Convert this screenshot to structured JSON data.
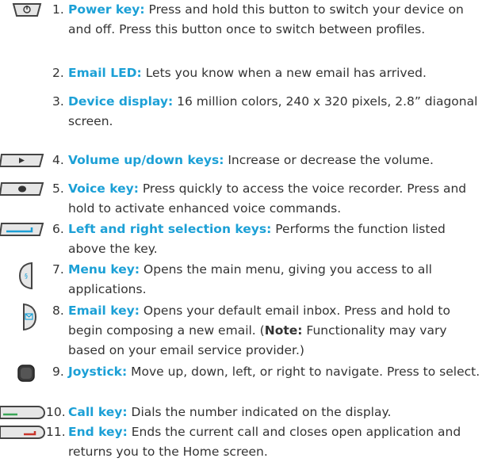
{
  "items": [
    {
      "num": "1.",
      "term": "Power key:",
      "desc": " Press and hold this button to switch your device on and off. Press this button once to switch between profiles.",
      "icon": "power-key-icon"
    },
    {
      "num": "2.",
      "term": "Email LED:",
      "desc": " Lets you know when a new email has arrived.",
      "icon": ""
    },
    {
      "num": "3.",
      "term": "Device display:",
      "desc": " 16 million colors, 240 x 320 pixels, 2.8” diagonal screen.",
      "icon": ""
    },
    {
      "num": "4.",
      "term": "Volume up/down keys:",
      "desc": " Increase or decrease the volume.",
      "icon": "volume-key-icon"
    },
    {
      "num": "5.",
      "term": "Voice key:",
      "desc": " Press quickly to access the voice recorder. Press and hold to activate enhanced voice commands.",
      "icon": "voice-key-icon"
    },
    {
      "num": "6.",
      "term": "Left and right selection keys:",
      "desc": " Performs the function listed above the key.",
      "icon": "selection-key-icon"
    },
    {
      "num": "7.",
      "term": "Menu key:",
      "desc": " Opens the main menu, giving you access to all applications.",
      "icon": "menu-key-icon"
    },
    {
      "num": "8.",
      "term": "Email key:",
      "desc_before": " Opens your default email inbox. Press and hold to begin composing a new email. (",
      "note_label": "Note:",
      "desc_after": " Functionality may vary based on your email service provider.)",
      "icon": "email-key-icon"
    },
    {
      "num": "9.",
      "term": "Joystick:",
      "desc": " Move up, down, left, or right to navigate. Press to select.",
      "icon": "joystick-icon"
    },
    {
      "num": "10.",
      "term": "Call key:",
      "desc": " Dials the number indicated on the display.",
      "icon": "call-key-icon"
    },
    {
      "num": "11.",
      "term": "End key:",
      "desc": " Ends the current call and closes open application and returns you to the Home screen.",
      "icon": "end-key-icon"
    }
  ],
  "colors": {
    "term": "#1ca0d6",
    "text": "#333333",
    "call": "#3aa657",
    "end": "#c8352b",
    "selection": "#1ca0d6",
    "key_body": "#e6e6e6",
    "key_edge": "#444444"
  }
}
